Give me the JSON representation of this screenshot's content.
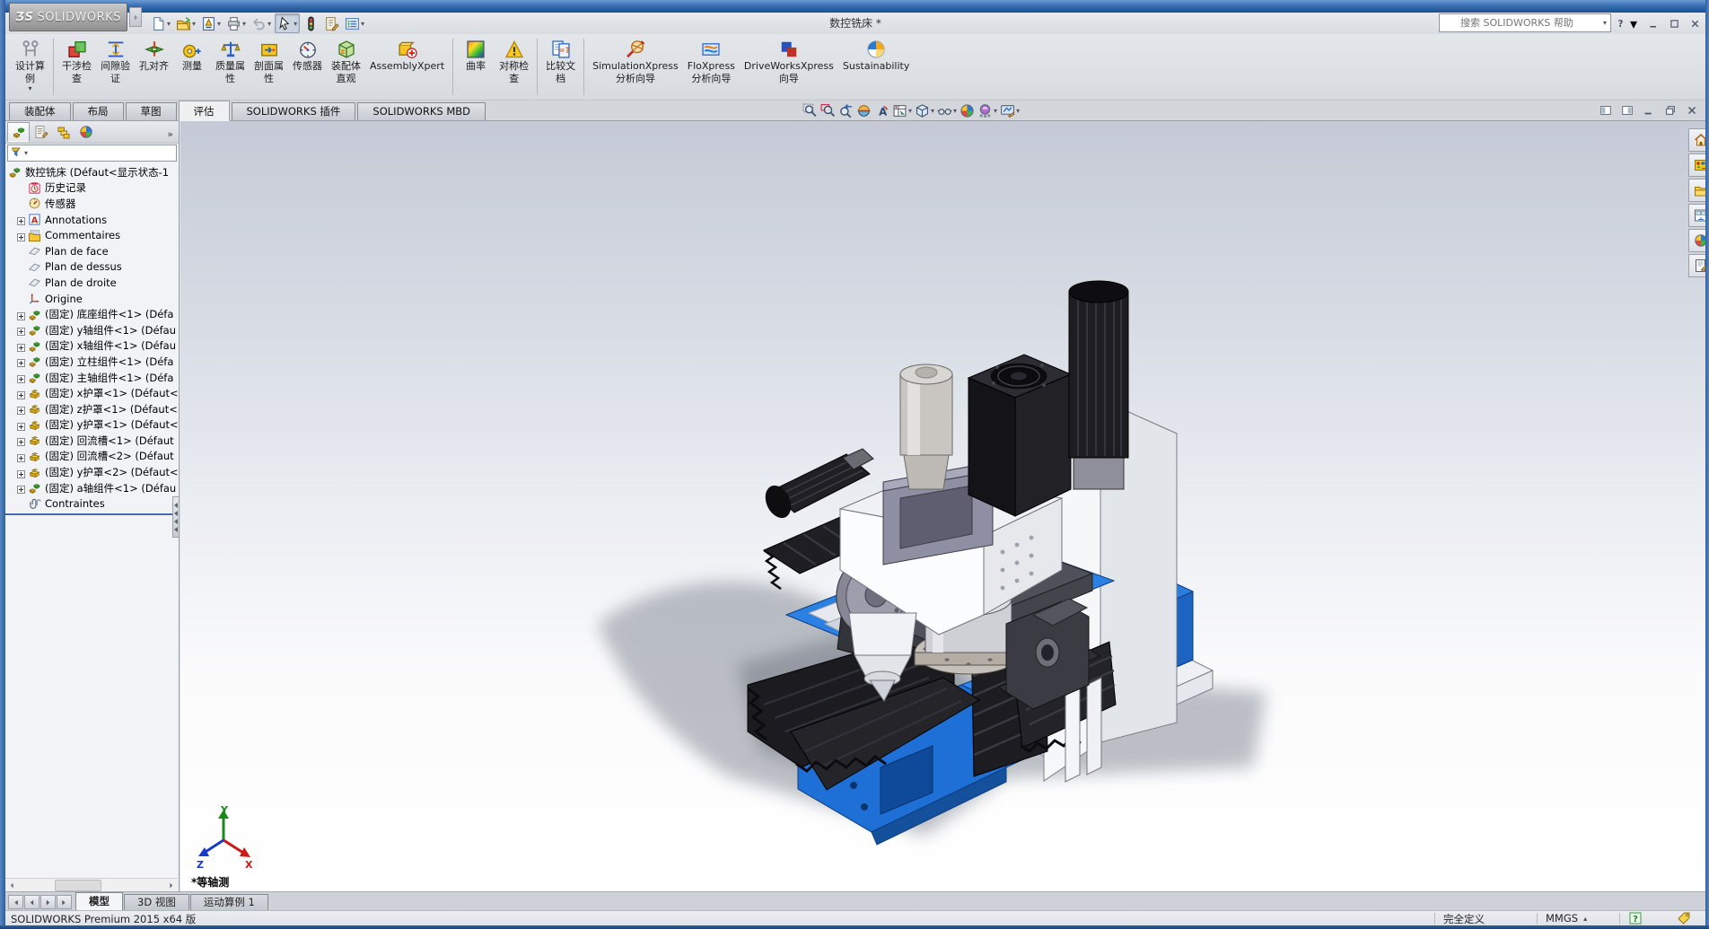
{
  "window": {
    "logo_brand": "SOLIDWORKS",
    "logo_mark": "ƷS",
    "title": "数控铣床 *"
  },
  "glyphs": {
    "dropdown": "▾",
    "chevron_more": "»",
    "scroll_left": "◄",
    "scroll_right": "►"
  },
  "search": {
    "placeholder": "搜索 SOLIDWORKS 帮助"
  },
  "quickbar": {
    "items": [
      {
        "name": "new-document-button",
        "icon": "new-doc-icon",
        "dropdown": true
      },
      {
        "name": "open-document-button",
        "icon": "open-folder-icon",
        "dropdown": true
      },
      {
        "name": "publish-edrawings-button",
        "icon": "publish-doc-icon",
        "dropdown": true
      },
      {
        "name": "print-button",
        "icon": "print-icon",
        "dropdown": true
      },
      {
        "name": "undo-button",
        "icon": "undo-icon",
        "dropdown": true
      },
      {
        "name": "select-tool-button",
        "icon": "select-cursor-icon",
        "dropdown": true,
        "pressed": true
      },
      {
        "name": "rebuild-button",
        "icon": "rebuild-icon",
        "dropdown": false
      },
      {
        "name": "file-properties-button",
        "icon": "file-properties-icon",
        "dropdown": false
      },
      {
        "name": "options-button",
        "icon": "options-icon",
        "dropdown": true
      }
    ]
  },
  "titlebar_controls": {
    "items": [
      {
        "name": "minimize-button",
        "icon": "minimize-icon"
      },
      {
        "name": "restore-button",
        "icon": "restore-icon"
      },
      {
        "name": "close-button",
        "icon": "close-icon"
      }
    ]
  },
  "ribbon": {
    "groups": [
      {
        "items": [
          {
            "name": "design-study-button",
            "icon": "design-study-icon",
            "label": "设计算",
            "label2": "例",
            "dropdown": true
          }
        ]
      },
      {
        "items": [
          {
            "name": "interference-detection-button",
            "icon": "interference-icon",
            "label": "干涉检",
            "label2": "查"
          },
          {
            "name": "clearance-verification-button",
            "icon": "clearance-icon",
            "label": "间隙验",
            "label2": "证"
          },
          {
            "name": "hole-alignment-button",
            "icon": "hole-align-icon",
            "label": "孔对齐"
          },
          {
            "name": "measure-button",
            "icon": "measure-icon",
            "label": "测量"
          },
          {
            "name": "mass-properties-button",
            "icon": "mass-props-icon",
            "label": "质量属",
            "label2": "性"
          },
          {
            "name": "section-properties-button",
            "icon": "section-props-icon",
            "label": "剖面属",
            "label2": "性"
          },
          {
            "name": "sensors-button",
            "icon": "sensors-icon",
            "label": "传感器"
          },
          {
            "name": "assembly-visualization-button",
            "icon": "assembly-visualization-icon",
            "label": "装配体",
            "label2": "直观"
          },
          {
            "name": "assemblyxpert-button",
            "icon": "assemblyxpert-icon",
            "label": "AssemblyXpert"
          }
        ]
      },
      {
        "items": [
          {
            "name": "curvature-button",
            "icon": "curvature-icon",
            "label": "曲率"
          },
          {
            "name": "symmetry-check-button",
            "icon": "symmetry-check-icon",
            "label": "对称检",
            "label2": "查"
          }
        ]
      },
      {
        "items": [
          {
            "name": "compare-documents-button",
            "icon": "compare-docs-icon",
            "label": "比较文",
            "label2": "档"
          }
        ]
      },
      {
        "items": [
          {
            "name": "simulationxpress-button",
            "icon": "simulationxpress-icon",
            "label": "SimulationXpress",
            "label2": "分析向导"
          },
          {
            "name": "floxpress-button",
            "icon": "floxpress-icon",
            "label": "FloXpress",
            "label2": "分析向导"
          },
          {
            "name": "driveworksxpress-button",
            "icon": "driveworksxpress-icon",
            "label": "DriveWorksXpress",
            "label2": "向导"
          },
          {
            "name": "sustainability-button",
            "icon": "sustainability-icon",
            "label": "Sustainability"
          }
        ]
      }
    ]
  },
  "command_tabs": {
    "items": [
      {
        "label": "装配体",
        "active": false
      },
      {
        "label": "布局",
        "active": false
      },
      {
        "label": "草图",
        "active": false
      },
      {
        "label": "评估",
        "active": true
      },
      {
        "label": "SOLIDWORKS 插件",
        "active": false
      },
      {
        "label": "SOLIDWORKS MBD",
        "active": false
      }
    ]
  },
  "headsup": {
    "items": [
      {
        "name": "zoom-to-fit-button",
        "icon": "zoom-fit-icon"
      },
      {
        "name": "zoom-to-area-button",
        "icon": "zoom-area-icon"
      },
      {
        "name": "previous-view-button",
        "icon": "previous-view-icon"
      },
      {
        "name": "section-view-button",
        "icon": "section-view-icon"
      },
      {
        "name": "annotation-views-button",
        "icon": "annotation-views-icon"
      },
      {
        "name": "view-orientation-button",
        "icon": "view-orientation-icon",
        "dropdown": true
      },
      {
        "name": "display-style-button",
        "icon": "display-style-icon",
        "dropdown": true
      },
      {
        "name": "hide-show-items-button",
        "icon": "hide-show-icon",
        "dropdown": true
      },
      {
        "name": "edit-appearance-button",
        "icon": "edit-appearance-icon"
      },
      {
        "name": "apply-scene-button",
        "icon": "apply-scene-icon",
        "dropdown": true
      },
      {
        "name": "view-settings-button",
        "icon": "view-settings-icon",
        "dropdown": true
      }
    ]
  },
  "doc_controls": {
    "items": [
      {
        "name": "tile-left-button",
        "icon": "tile-left-icon"
      },
      {
        "name": "tile-right-button",
        "icon": "tile-right-icon"
      },
      {
        "name": "doc-minimize-button",
        "icon": "minimize-icon"
      },
      {
        "name": "doc-restore-button",
        "icon": "restore-win-icon"
      },
      {
        "name": "doc-close-button",
        "icon": "close-icon"
      }
    ]
  },
  "feature_tree": {
    "selector_tabs": [
      {
        "name": "featuremanager-tab",
        "icon": "assembly-icon",
        "active": true
      },
      {
        "name": "propertymanager-tab",
        "icon": "propertymanager-icon",
        "active": false
      },
      {
        "name": "configurationmanager-tab",
        "icon": "configurationmanager-icon",
        "active": false
      },
      {
        "name": "displaymanager-tab",
        "icon": "edit-appearance-icon",
        "active": false
      }
    ],
    "items": [
      {
        "icon": "assembly-icon",
        "label": "数控铣床 (Défaut<显示状态-1",
        "root": true
      },
      {
        "icon": "history-icon",
        "label": "历史记录"
      },
      {
        "icon": "sensor-tree-icon",
        "label": "传感器"
      },
      {
        "icon": "annotations-icon",
        "label": "Annotations",
        "plus": true
      },
      {
        "icon": "comments-icon",
        "label": "Commentaires",
        "plus": true
      },
      {
        "icon": "plane-icon",
        "label": "Plan de face"
      },
      {
        "icon": "plane-icon",
        "label": "Plan de dessus"
      },
      {
        "icon": "plane-icon",
        "label": "Plan de droite"
      },
      {
        "icon": "origin-icon",
        "label": "Origine"
      },
      {
        "icon": "assembly-icon",
        "label": "(固定) 底座组件<1> (Défa",
        "plus": true
      },
      {
        "icon": "assembly-icon",
        "label": "(固定) y轴组件<1> (Défau",
        "plus": true
      },
      {
        "icon": "assembly-icon",
        "label": "(固定) x轴组件<1> (Défau",
        "plus": true
      },
      {
        "icon": "assembly-icon",
        "label": "(固定) 立柱组件<1> (Défa",
        "plus": true
      },
      {
        "icon": "assembly-icon",
        "label": "(固定) 主轴组件<1> (Défa",
        "plus": true
      },
      {
        "icon": "part-icon",
        "label": "(固定) x护罩<1> (Défaut<",
        "plus": true
      },
      {
        "icon": "part-icon",
        "label": "(固定) z护罩<1> (Défaut<",
        "plus": true
      },
      {
        "icon": "part-icon",
        "label": "(固定) y护罩<1> (Défaut<",
        "plus": true
      },
      {
        "icon": "part-icon",
        "label": "(固定) 回流槽<1> (Défaut",
        "plus": true
      },
      {
        "icon": "part-icon",
        "label": "(固定) 回流槽<2> (Défaut",
        "plus": true
      },
      {
        "icon": "part-icon",
        "label": "(固定) y护罩<2> (Défaut<",
        "plus": true
      },
      {
        "icon": "assembly-icon",
        "label": "(固定) a轴组件<1> (Défau",
        "plus": true
      },
      {
        "icon": "mates-icon",
        "label": "Contraintes"
      }
    ]
  },
  "graphics": {
    "view_label": "*等轴测",
    "triad": {
      "x": "X",
      "y": "Y",
      "z": "Z"
    },
    "accent_colors": {
      "machine_blue": "#2b80e4",
      "bellows_black": "#1c1c21",
      "body_white": "#f5f6f8"
    }
  },
  "taskpane": {
    "items": [
      {
        "name": "solidworks-resources-tab",
        "icon": "home-icon"
      },
      {
        "name": "design-library-tab",
        "icon": "design-library-icon"
      },
      {
        "name": "file-explorer-tab",
        "icon": "file-explorer-icon"
      },
      {
        "name": "view-palette-tab",
        "icon": "view-palette-icon"
      },
      {
        "name": "appearances-scenes-tab",
        "icon": "edit-appearance-icon"
      },
      {
        "name": "custom-properties-tab",
        "icon": "custom-properties-icon"
      }
    ]
  },
  "bottom_bar": {
    "nav": [
      {
        "name": "first-tab-button",
        "icon": "nav-first-icon"
      },
      {
        "name": "prev-tab-button",
        "icon": "nav-prev-icon"
      },
      {
        "name": "next-tab-button",
        "icon": "nav-next-icon"
      },
      {
        "name": "last-tab-button",
        "icon": "nav-last-icon"
      }
    ],
    "tabs": [
      {
        "label": "模型",
        "active": true
      },
      {
        "label": "3D 视图",
        "active": false
      },
      {
        "label": "运动算例 1",
        "active": false
      }
    ]
  },
  "statusbar": {
    "left_text": "SOLIDWORKS Premium 2015 x64 版",
    "define_state": "完全定义",
    "units": "MMGS"
  }
}
